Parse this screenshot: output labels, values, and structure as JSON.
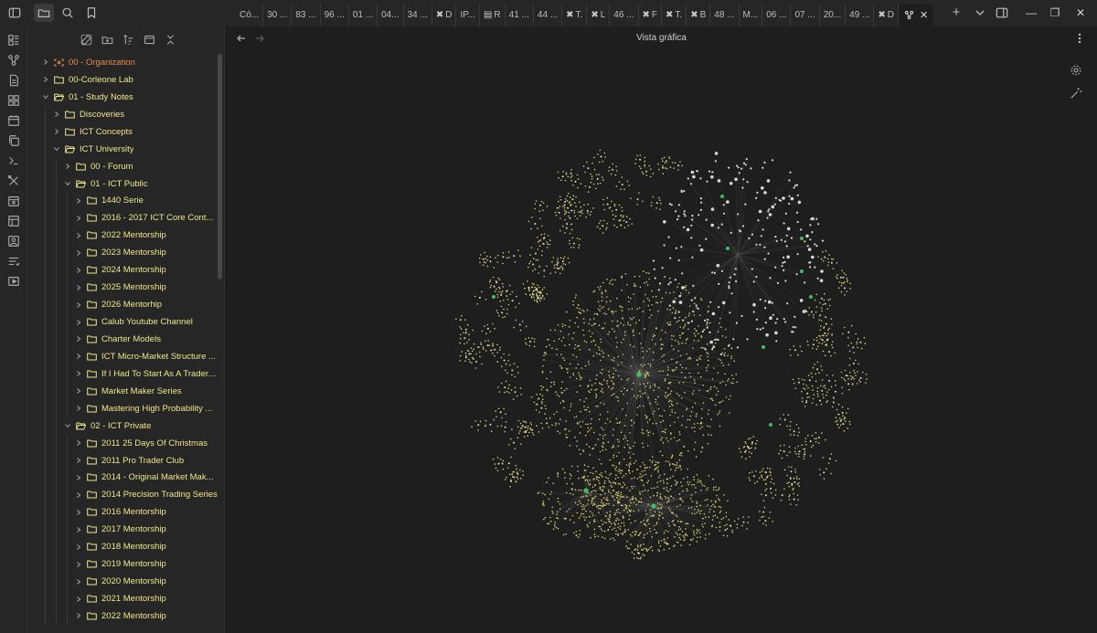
{
  "tabs": [
    {
      "label": "Có...",
      "icon": ""
    },
    {
      "label": "30 ...",
      "icon": ""
    },
    {
      "label": "83 ...",
      "icon": ""
    },
    {
      "label": "96 ...",
      "icon": ""
    },
    {
      "label": "01 ...",
      "icon": ""
    },
    {
      "label": "04...",
      "icon": ""
    },
    {
      "label": "34 ...",
      "icon": ""
    },
    {
      "label": "D",
      "icon": "✖"
    },
    {
      "label": "IP...",
      "icon": ""
    },
    {
      "label": "R",
      "icon": "▤"
    },
    {
      "label": "41 ...",
      "icon": ""
    },
    {
      "label": "44 ...",
      "icon": ""
    },
    {
      "label": "T.",
      "icon": "✖"
    },
    {
      "label": "L",
      "icon": "✖"
    },
    {
      "label": "46 ...",
      "icon": ""
    },
    {
      "label": "F",
      "icon": "✖"
    },
    {
      "label": "T.",
      "icon": "✖"
    },
    {
      "label": "B",
      "icon": "✖"
    },
    {
      "label": "48 ...",
      "icon": ""
    },
    {
      "label": "M...",
      "icon": ""
    },
    {
      "label": "06 ...",
      "icon": ""
    },
    {
      "label": "07 ...",
      "icon": ""
    },
    {
      "label": "20...",
      "icon": ""
    },
    {
      "label": "49 ...",
      "icon": ""
    },
    {
      "label": "D",
      "icon": "✖"
    }
  ],
  "active_tab": {
    "close": "✕"
  },
  "tabbar": {
    "plus": "+"
  },
  "window": {
    "minimize": "—",
    "maximize": "❐",
    "close": "✕"
  },
  "tree": [
    {
      "label": "00 - Organization",
      "depth": 0,
      "open": false,
      "org": true
    },
    {
      "label": "00-Corleone Lab",
      "depth": 0,
      "open": false
    },
    {
      "label": "01 - Study Notes",
      "depth": 0,
      "open": true
    },
    {
      "label": "Discoveries",
      "depth": 1,
      "open": false
    },
    {
      "label": "ICT Concepts",
      "depth": 1,
      "open": false
    },
    {
      "label": "ICT University",
      "depth": 1,
      "open": true
    },
    {
      "label": "00 - Forum",
      "depth": 2,
      "open": false
    },
    {
      "label": "01 - ICT Public",
      "depth": 2,
      "open": true
    },
    {
      "label": "1440 Serie",
      "depth": 3,
      "open": false
    },
    {
      "label": "2016 - 2017 ICT Core Cont...",
      "depth": 3,
      "open": false
    },
    {
      "label": "2022 Mentorship",
      "depth": 3,
      "open": false
    },
    {
      "label": "2023 Mentorship",
      "depth": 3,
      "open": false
    },
    {
      "label": "2024 Mentorship",
      "depth": 3,
      "open": false
    },
    {
      "label": "2025 Mentorship",
      "depth": 3,
      "open": false
    },
    {
      "label": "2026 Mentorhip",
      "depth": 3,
      "open": false
    },
    {
      "label": "Calub Youtube Channel",
      "depth": 3,
      "open": false
    },
    {
      "label": "Charter Models",
      "depth": 3,
      "open": false
    },
    {
      "label": "ICT Micro-Market Structure ...",
      "depth": 3,
      "open": false
    },
    {
      "label": "If I Had To Start As A Trader,...",
      "depth": 3,
      "open": false
    },
    {
      "label": "Market Maker Series",
      "depth": 3,
      "open": false
    },
    {
      "label": "Mastering High Probability ...",
      "depth": 3,
      "open": false
    },
    {
      "label": "02 - ICT Private",
      "depth": 2,
      "open": true
    },
    {
      "label": "2011 25 Days Of Christmas",
      "depth": 3,
      "open": false
    },
    {
      "label": "2011 Pro Trader Club",
      "depth": 3,
      "open": false
    },
    {
      "label": "2014 - Original Market Mak...",
      "depth": 3,
      "open": false
    },
    {
      "label": "2014 Precision Trading Series",
      "depth": 3,
      "open": false
    },
    {
      "label": "2016 Mentorship",
      "depth": 3,
      "open": false
    },
    {
      "label": "2017 Mentorship",
      "depth": 3,
      "open": false
    },
    {
      "label": "2018 Mentorship",
      "depth": 3,
      "open": false
    },
    {
      "label": "2019 Mentorship",
      "depth": 3,
      "open": false
    },
    {
      "label": "2020 Mentorship",
      "depth": 3,
      "open": false
    },
    {
      "label": "2021 Mentorship",
      "depth": 3,
      "open": false
    },
    {
      "label": "2022 Mentorship",
      "depth": 3,
      "open": false
    }
  ],
  "main": {
    "view_title": "Vista gráfica"
  },
  "colors": {
    "folder": "#f0e68c",
    "org_folder": "#e88a4a",
    "node_default": "#d8d8d8",
    "node_file": "#d6cc6e",
    "node_tag": "#3fbf5f",
    "edge": "#5a5a5a",
    "background": "#1e1e1e"
  },
  "graph": {
    "view": "graph",
    "highlighted_node_color": "green",
    "clusters": [
      "hub-center",
      "hub-top-right",
      "hub-bottom-left",
      "hub-bottom-center",
      "ring-of-small-clusters"
    ]
  }
}
